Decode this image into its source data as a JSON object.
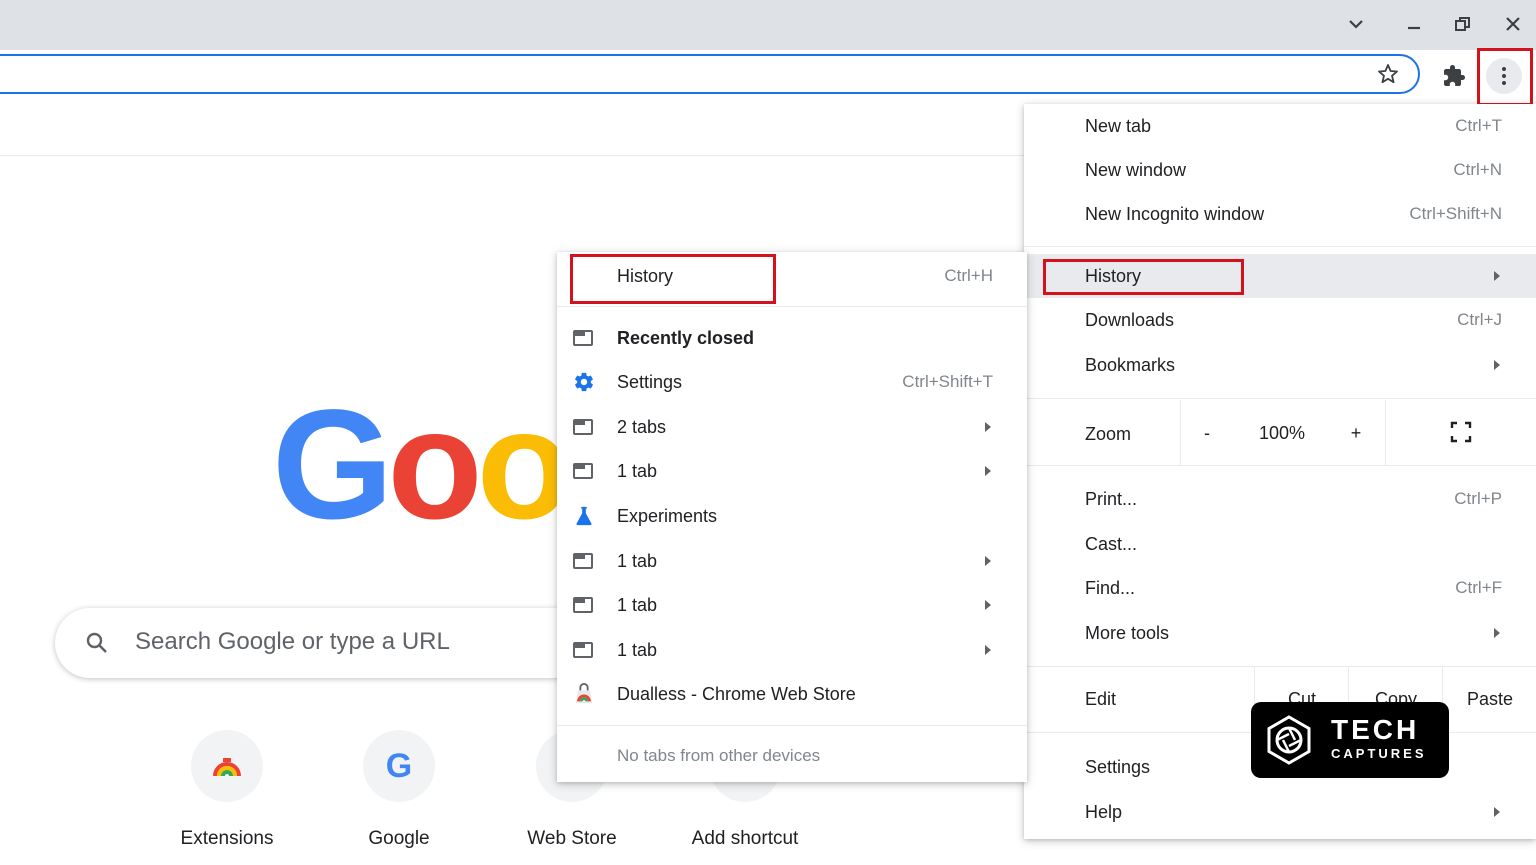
{
  "window": {
    "controls": [
      "chevron-down",
      "minimize",
      "restore",
      "close"
    ]
  },
  "toolbar": {
    "icons": [
      "star-icon",
      "extensions-puzzle-icon",
      "more-vert-icon"
    ]
  },
  "ntp": {
    "logo_text": "Goog",
    "search_placeholder": "Search Google or type a URL",
    "shortcuts": [
      {
        "label": "Extensions"
      },
      {
        "label": "Google"
      },
      {
        "label": "Web Store"
      },
      {
        "label": "Add shortcut"
      }
    ]
  },
  "main_menu": {
    "new_tab": {
      "label": "New tab",
      "shortcut": "Ctrl+T"
    },
    "new_window": {
      "label": "New window",
      "shortcut": "Ctrl+N"
    },
    "new_incognito": {
      "label": "New Incognito window",
      "shortcut": "Ctrl+Shift+N"
    },
    "history": {
      "label": "History"
    },
    "downloads": {
      "label": "Downloads",
      "shortcut": "Ctrl+J"
    },
    "bookmarks": {
      "label": "Bookmarks"
    },
    "zoom": {
      "label": "Zoom",
      "minus": "-",
      "value": "100%",
      "plus": "+"
    },
    "print": {
      "label": "Print...",
      "shortcut": "Ctrl+P"
    },
    "cast": {
      "label": "Cast..."
    },
    "find": {
      "label": "Find...",
      "shortcut": "Ctrl+F"
    },
    "more_tools": {
      "label": "More tools"
    },
    "edit": {
      "label": "Edit",
      "cut": "Cut",
      "copy": "Copy",
      "paste": "Paste"
    },
    "settings": {
      "label": "Settings"
    },
    "help": {
      "label": "Help"
    }
  },
  "history_submenu": {
    "history": {
      "label": "History",
      "shortcut": "Ctrl+H"
    },
    "recently_closed": "Recently closed",
    "items": [
      {
        "label": "Settings",
        "shortcut": "Ctrl+Shift+T",
        "icon": "settings-gear-icon",
        "arrow": false
      },
      {
        "label": "2 tabs",
        "shortcut": "",
        "icon": "tab-window-icon",
        "arrow": true
      },
      {
        "label": "1 tab",
        "shortcut": "",
        "icon": "tab-window-icon",
        "arrow": true
      },
      {
        "label": "Experiments",
        "shortcut": "",
        "icon": "flask-icon",
        "arrow": false
      },
      {
        "label": "1 tab",
        "shortcut": "",
        "icon": "tab-window-icon",
        "arrow": true
      },
      {
        "label": "1 tab",
        "shortcut": "",
        "icon": "tab-window-icon",
        "arrow": true
      },
      {
        "label": "1 tab",
        "shortcut": "",
        "icon": "tab-window-icon",
        "arrow": true
      },
      {
        "label": "Dualless - Chrome Web Store",
        "shortcut": "",
        "icon": "webstore-icon",
        "arrow": false
      }
    ],
    "no_tabs": "No tabs from other devices"
  },
  "watermark": {
    "line1": "TECH",
    "line2": "CAPTURES"
  },
  "colors": {
    "highlight_red": "#d3121d",
    "accent_blue": "#1a73e8",
    "menu_hover": "#e8eaed"
  }
}
